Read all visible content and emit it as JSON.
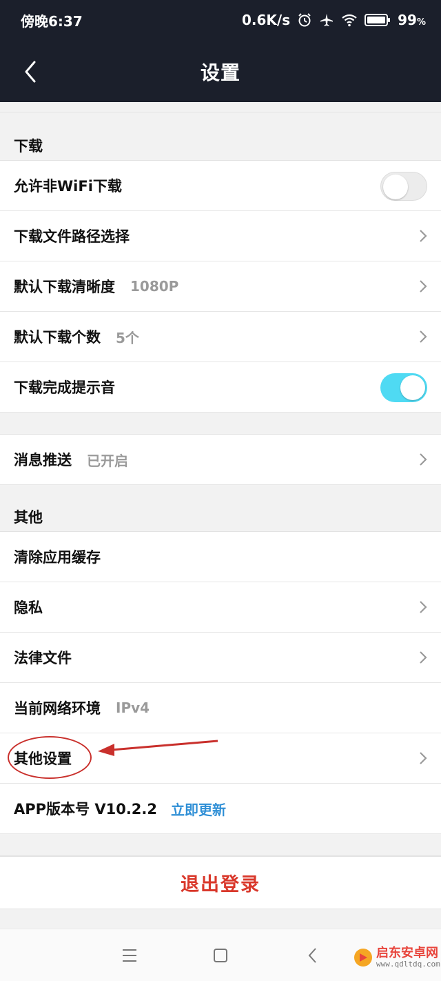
{
  "status_bar": {
    "time": "傍晚6:37",
    "speed": "0.6K/s",
    "battery": "99",
    "battery_unit": "%",
    "icons": [
      "alarm-icon",
      "airplane-icon",
      "wifi-icon",
      "battery-icon"
    ]
  },
  "header": {
    "title": "设置",
    "back_icon": "chevron-left-icon"
  },
  "sections": {
    "download": {
      "header": "下载",
      "items": [
        {
          "label": "允许非WiFi下载",
          "control": "toggle",
          "toggle_on": false
        },
        {
          "label": "下载文件路径选择",
          "control": "chevron"
        },
        {
          "label": "默认下载清晰度",
          "value": "1080P",
          "control": "chevron"
        },
        {
          "label": "默认下载个数",
          "value": "5个",
          "control": "chevron"
        },
        {
          "label": "下载完成提示音",
          "control": "toggle",
          "toggle_on": true
        }
      ]
    },
    "push": {
      "items": [
        {
          "label": "消息推送",
          "value": "已开启",
          "control": "chevron"
        }
      ]
    },
    "other": {
      "header": "其他",
      "items": [
        {
          "label": "清除应用缓存"
        },
        {
          "label": "隐私",
          "control": "chevron"
        },
        {
          "label": "法律文件",
          "control": "chevron"
        },
        {
          "label": "当前网络环境",
          "value": "IPv4"
        },
        {
          "label": "其他设置",
          "control": "chevron"
        },
        {
          "label": "APP版本号 V10.2.2",
          "link": "立即更新"
        }
      ]
    }
  },
  "logout": {
    "label": "退出登录"
  },
  "nav_bar": {
    "icons": [
      "menu-icon",
      "home-square-icon",
      "back-triangle-icon"
    ]
  },
  "watermark": {
    "name": "启东安卓网",
    "url": "www.qdltdq.com"
  },
  "colors": {
    "header_bg": "#1b1f2b",
    "toggle_on": "#4fdaf3",
    "link": "#2f8fd6",
    "logout": "#d9382b",
    "annotation": "#c9302c"
  }
}
